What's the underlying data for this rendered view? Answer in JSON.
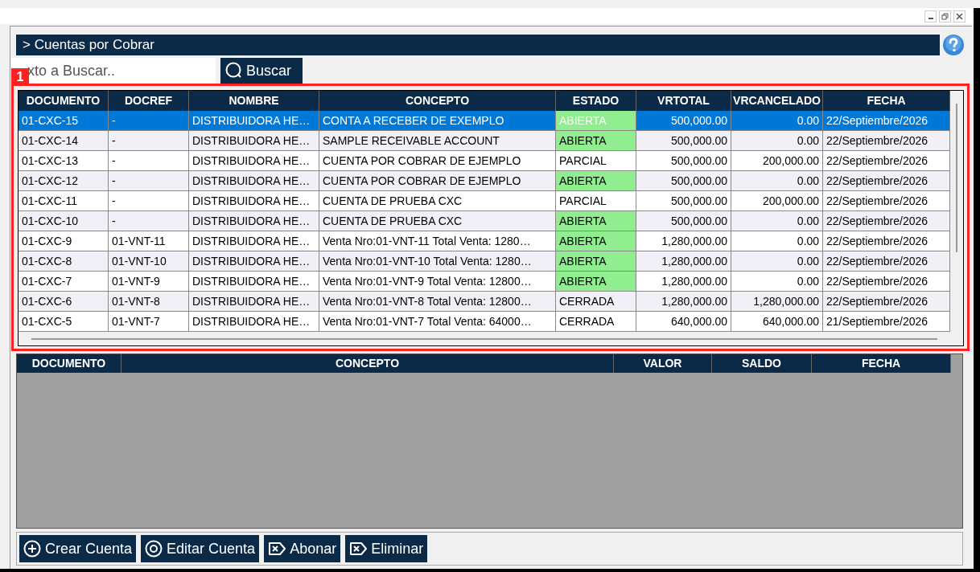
{
  "panel": {
    "title": "> Cuentas por Cobrar"
  },
  "search": {
    "placeholder": "xto a Buscar..",
    "button": "Buscar"
  },
  "annotation": {
    "label": "1"
  },
  "table": {
    "columns": [
      "DOCUMENTO",
      "DOCREF",
      "NOMBRE",
      "CONCEPTO",
      "ESTADO",
      "VRTOTAL",
      "VRCANCELADO",
      "FECHA"
    ],
    "rows": [
      {
        "selected": true,
        "cells": [
          "01-CXC-15",
          "-",
          "DISTRIBUIDORA HE…",
          "CONTA A RECEBER DE EXEMPLO",
          "ABIERTA",
          "500,000.00",
          "0.00",
          "22/Septiembre/2026"
        ],
        "highlighted": true
      },
      {
        "selected": false,
        "cells": [
          "01-CXC-14",
          "-",
          "DISTRIBUIDORA HE…",
          "SAMPLE RECEIVABLE ACCOUNT",
          "ABIERTA",
          "500,000.00",
          "0.00",
          "22/Septiembre/2026"
        ],
        "highlighted": true
      },
      {
        "selected": false,
        "cells": [
          "01-CXC-13",
          "-",
          "DISTRIBUIDORA HE…",
          "CUENTA POR COBRAR DE EJEMPLO",
          "PARCIAL",
          "500,000.00",
          "200,000.00",
          "22/Septiembre/2026"
        ],
        "highlighted": false
      },
      {
        "selected": false,
        "cells": [
          "01-CXC-12",
          "-",
          "DISTRIBUIDORA HE…",
          "CUENTA POR COBRAR DE EJEMPLO",
          "ABIERTA",
          "500,000.00",
          "0.00",
          "22/Septiembre/2026"
        ],
        "highlighted": true
      },
      {
        "selected": false,
        "cells": [
          "01-CXC-11",
          "-",
          "DISTRIBUIDORA HE…",
          "CUENTA DE PRUEBA CXC",
          "PARCIAL",
          "500,000.00",
          "200,000.00",
          "22/Septiembre/2026"
        ],
        "highlighted": false
      },
      {
        "selected": false,
        "cells": [
          "01-CXC-10",
          "-",
          "DISTRIBUIDORA HE…",
          "CUENTA DE PRUEBA CXC",
          "ABIERTA",
          "500,000.00",
          "0.00",
          "22/Septiembre/2026"
        ],
        "highlighted": true
      },
      {
        "selected": false,
        "cells": [
          "01-CXC-9",
          "01-VNT-11",
          "DISTRIBUIDORA HE…",
          "Venta Nro:01-VNT-11 Total Venta: 1280…",
          "ABIERTA",
          "1,280,000.00",
          "0.00",
          "22/Septiembre/2026"
        ],
        "highlighted": true
      },
      {
        "selected": false,
        "cells": [
          "01-CXC-8",
          "01-VNT-10",
          "DISTRIBUIDORA HE…",
          "Venta Nro:01-VNT-10 Total Venta: 1280…",
          "ABIERTA",
          "1,280,000.00",
          "0.00",
          "22/Septiembre/2026"
        ],
        "highlighted": true
      },
      {
        "selected": false,
        "cells": [
          "01-CXC-7",
          "01-VNT-9",
          "DISTRIBUIDORA HE…",
          "Venta Nro:01-VNT-9 Total Venta: 12800…",
          "ABIERTA",
          "1,280,000.00",
          "0.00",
          "22/Septiembre/2026"
        ],
        "highlighted": true
      },
      {
        "selected": false,
        "cells": [
          "01-CXC-6",
          "01-VNT-8",
          "DISTRIBUIDORA HE…",
          "Venta Nro:01-VNT-8 Total Venta: 12800…",
          "CERRADA",
          "1,280,000.00",
          "1,280,000.00",
          "22/Septiembre/2026"
        ],
        "highlighted": false
      },
      {
        "selected": false,
        "cells": [
          "01-CXC-5",
          "01-VNT-7",
          "DISTRIBUIDORA HE…",
          "Venta Nro:01-VNT-7 Total Venta: 64000…",
          "CERRADA",
          "640,000.00",
          "640,000.00",
          "21/Septiembre/2026"
        ],
        "highlighted": false
      }
    ]
  },
  "detail_table": {
    "columns": [
      "DOCUMENTO",
      "CONCEPTO",
      "VALOR",
      "SALDO",
      "FECHA"
    ]
  },
  "buttons": [
    {
      "label": "Crear Cuenta",
      "kind": "plus"
    },
    {
      "label": "Editar Cuenta",
      "kind": "eye"
    },
    {
      "label": "Abonar",
      "kind": "x"
    },
    {
      "label": "Eliminar",
      "kind": "x"
    }
  ]
}
